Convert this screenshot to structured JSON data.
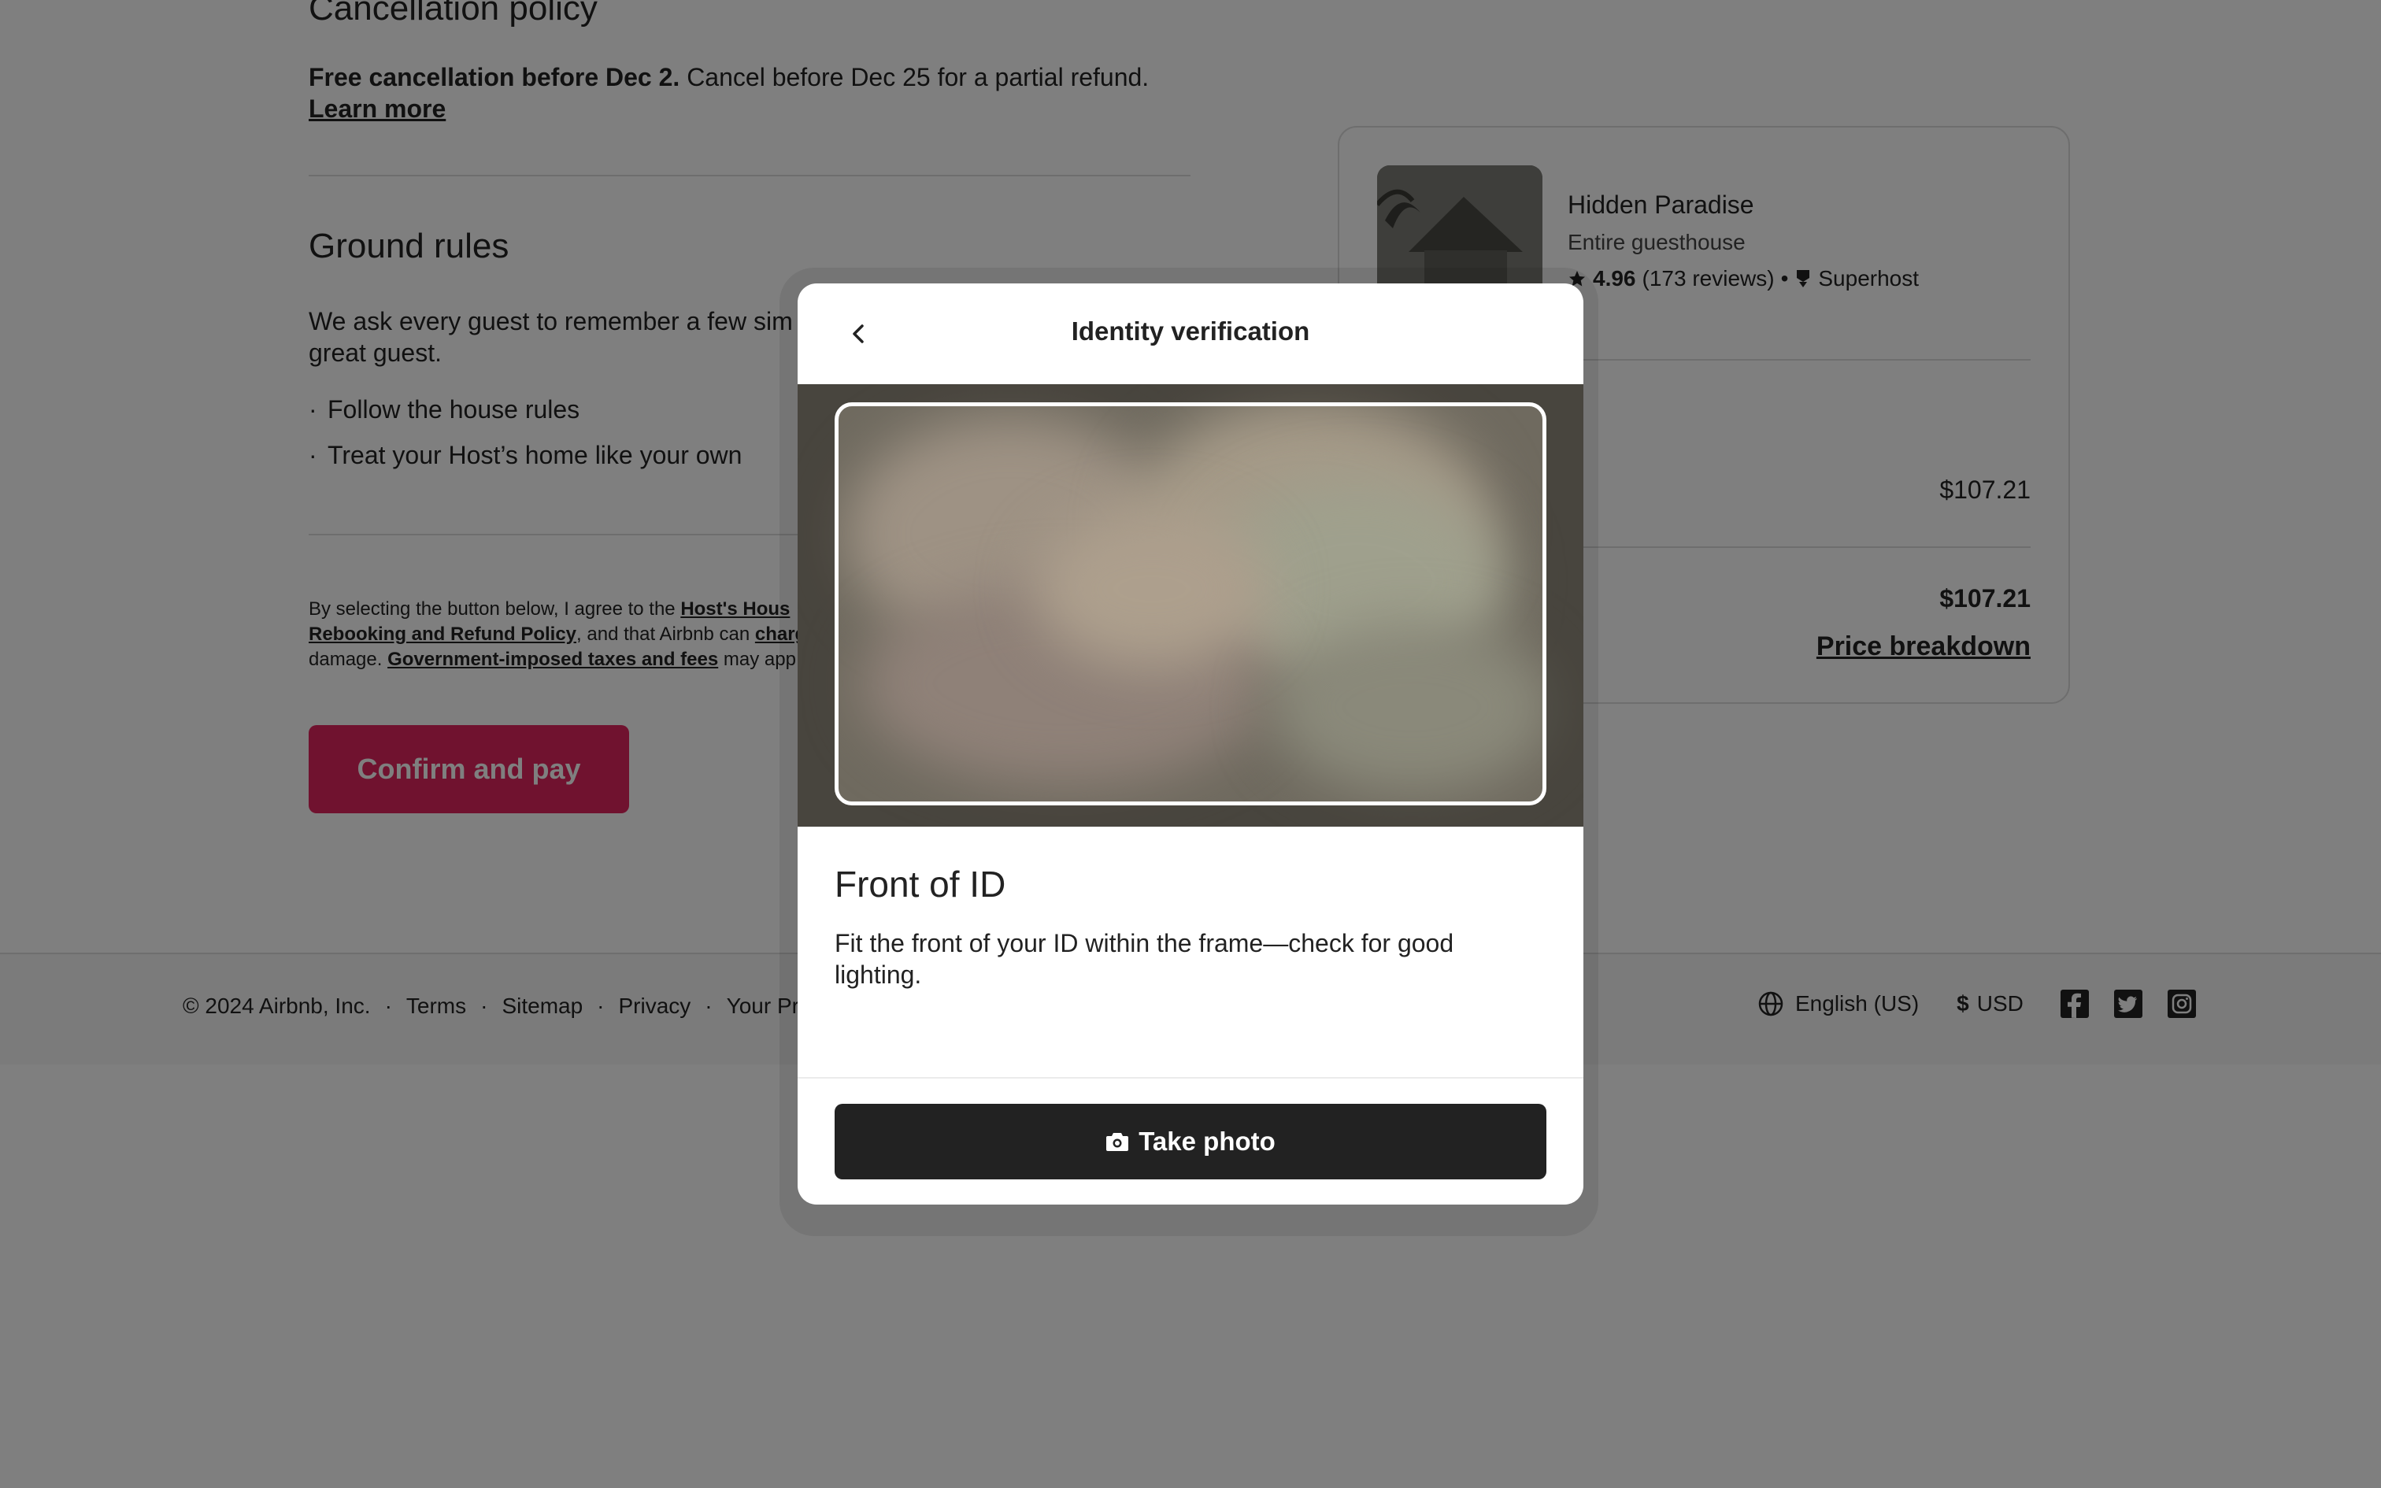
{
  "checkout": {
    "cancellation": {
      "heading": "Cancellation policy",
      "bold_text": "Free cancellation before Dec 2.",
      "text": " Cancel before Dec 25 for a partial refund.",
      "learn_more": "Learn more"
    },
    "ground_rules": {
      "heading": "Ground rules",
      "intro_visible": "We ask every guest to remember a few sim",
      "intro_line2": "great guest.",
      "rules": [
        "Follow the house rules",
        "Treat your Host’s home like your own"
      ],
      "bullet": "·"
    },
    "legal": {
      "part1": "By selecting the button below, I agree to the ",
      "link1": "Host's Hous",
      "link2": "Rebooking and Refund Policy",
      "part2": ", and that Airbnb can ",
      "link3": "charg",
      "part3": "damage. ",
      "link4": "Government-imposed taxes and fees",
      "part4": " may app"
    },
    "confirm_button": "Confirm and pay"
  },
  "summary": {
    "title": "Hidden Paradise",
    "subtitle": "Entire guesthouse",
    "rating": "4.96",
    "reviews": "(173 reviews)",
    "separator": "•",
    "badge": "Superhost",
    "price_line": "$107.21",
    "total": "$107.21",
    "price_breakdown": "Price breakdown"
  },
  "footer": {
    "copyright": "© 2024 Airbnb, Inc.",
    "links": [
      "Terms",
      "Sitemap",
      "Privacy",
      "Your Priv"
    ],
    "sep": "·",
    "language": "English (US)",
    "currency_symbol": "$",
    "currency": "USD",
    "social_icons": [
      "facebook-icon",
      "twitter-icon",
      "instagram-icon"
    ]
  },
  "modal": {
    "title": "Identity verification",
    "heading": "Front of ID",
    "description": "Fit the front of your ID within the frame—check for good lighting.",
    "take_photo": "Take photo",
    "icons": {
      "back": "chevron-left-icon",
      "camera": "camera-icon"
    }
  },
  "colors": {
    "brand": "#e0245e",
    "overlay": "rgba(0,0,0,0.5)",
    "dark_button": "#222222"
  }
}
